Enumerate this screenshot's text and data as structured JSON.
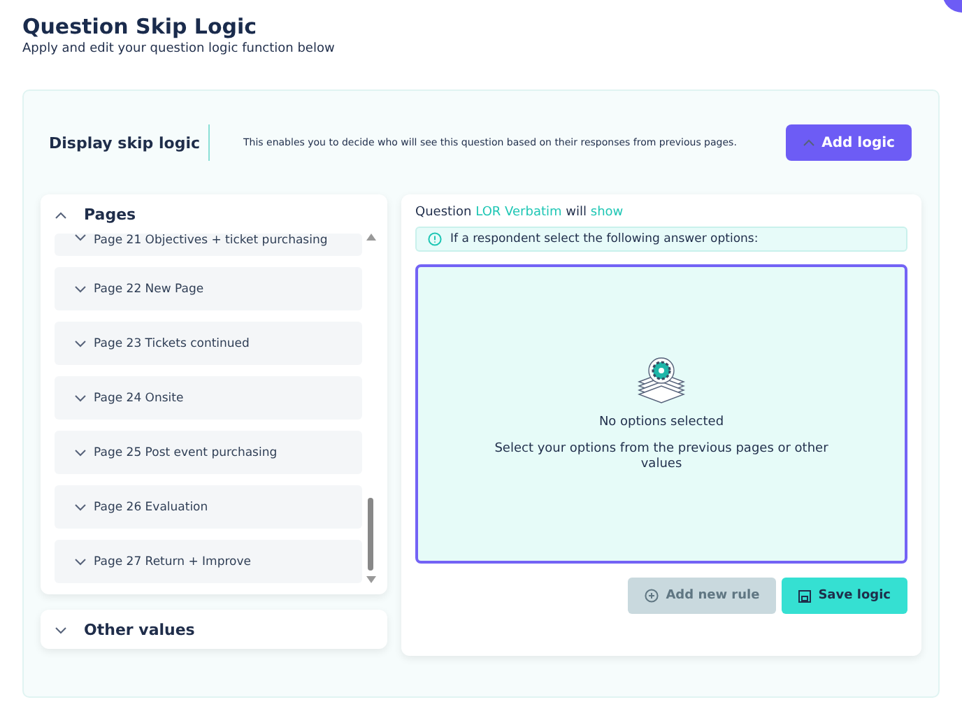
{
  "header": {
    "title": "Question Skip Logic",
    "subtitle": "Apply and edit your question logic function below"
  },
  "skip_logic": {
    "label": "Display skip logic",
    "description": "This enables you to decide who will see this question based on their responses from previous pages.",
    "button": "Add logic"
  },
  "sections": [
    {
      "title": "Pages",
      "expanded": true,
      "items": [
        {
          "label": "Page 21 Objectives + ticket purchasing"
        },
        {
          "label": "Page 22 New Page"
        },
        {
          "label": "Page 23 Tickets continued"
        },
        {
          "label": "Page 24 Onsite"
        },
        {
          "label": "Page 25 Post event purchasing"
        },
        {
          "label": "Page 26 Evaluation"
        },
        {
          "label": "Page 27 Return + Improve"
        }
      ]
    },
    {
      "title": "Other values",
      "expanded": false
    }
  ],
  "rule": {
    "prefix": "Question",
    "question": "LOR Verbatim",
    "verb": "will",
    "action": "show",
    "info": "If a respondent select the following answer options:",
    "empty_title": "No options selected",
    "empty_text": "Select your options from the previous pages or other values"
  },
  "buttons": [
    {
      "label": "Add new rule",
      "kind": "add",
      "disabled": true
    },
    {
      "label": "Save logic",
      "kind": "save",
      "disabled": false
    }
  ]
}
